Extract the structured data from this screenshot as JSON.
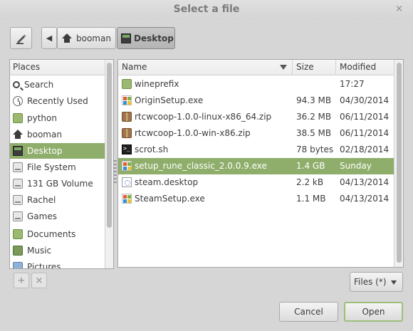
{
  "window": {
    "title": "Select a file",
    "close_glyph": "×"
  },
  "toolbar": {
    "back_glyph": "◀",
    "path": [
      {
        "label": "booman",
        "icon": "home-icon"
      },
      {
        "label": "Desktop",
        "icon": "desktop-folder-icon",
        "active": true
      }
    ]
  },
  "sidebar": {
    "header": "Places",
    "items": [
      {
        "label": "Search",
        "icon": "search-icon"
      },
      {
        "label": "Recently Used",
        "icon": "recent-icon"
      },
      {
        "label": "python",
        "icon": "folder-icon"
      },
      {
        "label": "booman",
        "icon": "home-icon"
      },
      {
        "label": "Desktop",
        "icon": "desktop-icon",
        "selected": true
      },
      {
        "label": "File System",
        "icon": "drive-icon"
      },
      {
        "label": "131 GB Volume",
        "icon": "drive-icon"
      },
      {
        "label": "Rachel",
        "icon": "drive-icon"
      },
      {
        "label": "Games",
        "icon": "drive-icon"
      },
      {
        "label": "Documents",
        "icon": "documents-folder-icon"
      },
      {
        "label": "Music",
        "icon": "music-folder-icon"
      },
      {
        "label": "Pictures",
        "icon": "pictures-folder-icon"
      }
    ],
    "add_glyph": "+",
    "remove_glyph": "×"
  },
  "files": {
    "columns": {
      "name": "Name",
      "size": "Size",
      "modified": "Modified"
    },
    "rows": [
      {
        "name": "wineprefix",
        "size": "",
        "modified": "17:27",
        "icon": "folder-icon"
      },
      {
        "name": "OriginSetup.exe",
        "size": "94.3 MB",
        "modified": "04/30/2014",
        "icon": "exe-icon"
      },
      {
        "name": "rtcwcoop-1.0.0-linux-x86_64.zip",
        "size": "36.2 MB",
        "modified": "06/11/2014",
        "icon": "zip-icon"
      },
      {
        "name": "rtcwcoop-1.0.0-win-x86.zip",
        "size": "38.5 MB",
        "modified": "06/11/2014",
        "icon": "zip-icon"
      },
      {
        "name": "scrot.sh",
        "size": "78 bytes",
        "modified": "02/18/2014",
        "icon": "script-icon"
      },
      {
        "name": "setup_rune_classic_2.0.0.9.exe",
        "size": "1.4 GB",
        "modified": "Sunday",
        "icon": "exe-icon",
        "selected": true
      },
      {
        "name": "steam.desktop",
        "size": "2.2 kB",
        "modified": "04/13/2014",
        "icon": "desktop-file-icon"
      },
      {
        "name": "SteamSetup.exe",
        "size": "1.1 MB",
        "modified": "04/13/2014",
        "icon": "exe-icon"
      }
    ]
  },
  "filter": {
    "value": "Files (*)"
  },
  "buttons": {
    "cancel": "Cancel",
    "open": "Open"
  }
}
